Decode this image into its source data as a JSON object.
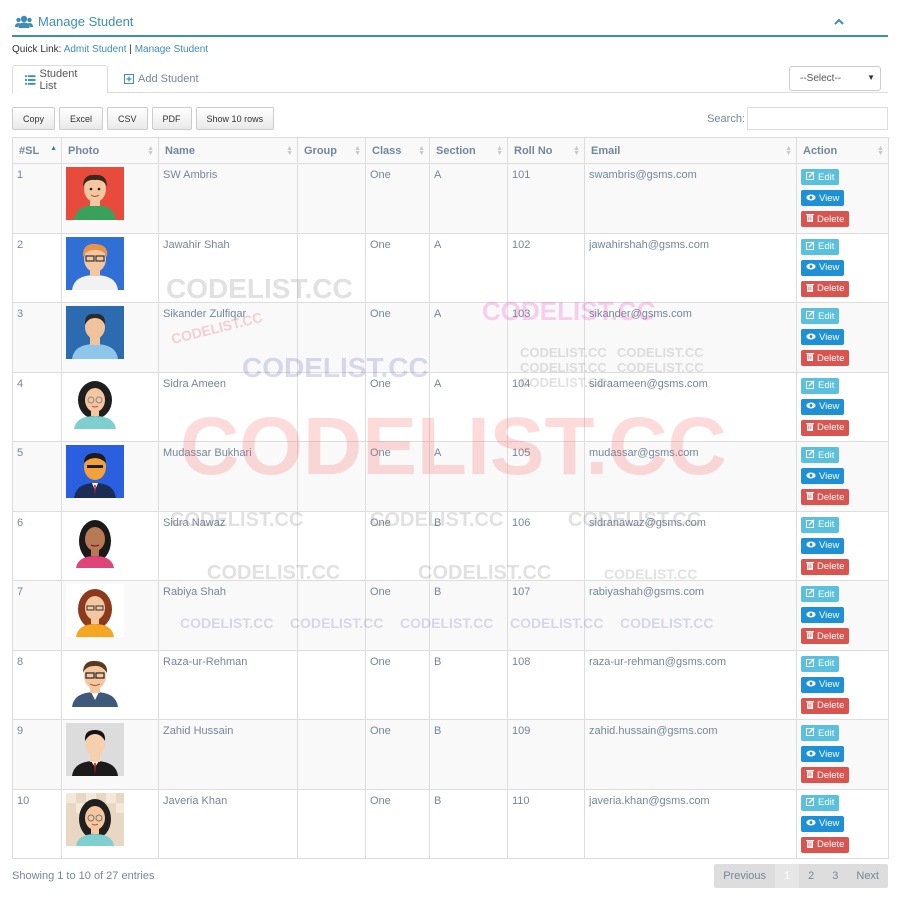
{
  "header": {
    "title": "Manage Student",
    "collapse_icon": "chevron-up-icon"
  },
  "quicklink": {
    "label": "Quick Link:",
    "link1": "Admit Student",
    "sep": "|",
    "link2": "Manage Student"
  },
  "tabs": {
    "student_list": "Student List",
    "add_student": "Add Student"
  },
  "select": {
    "value": "--Select--"
  },
  "buttons": {
    "copy": "Copy",
    "excel": "Excel",
    "csv": "CSV",
    "pdf": "PDF",
    "show_rows": "Show 10 rows"
  },
  "search": {
    "label": "Search:",
    "value": ""
  },
  "columns": [
    "#SL",
    "Photo",
    "Name",
    "Group",
    "Class",
    "Section",
    "Roll No",
    "Email",
    "Action"
  ],
  "actions": {
    "edit": "Edit",
    "view": "View",
    "delete": "Delete"
  },
  "rows": [
    {
      "sl": "1",
      "name": "SW Ambris",
      "group": "",
      "class": "One",
      "section": "A",
      "roll": "101",
      "email": "swambris@gsms.com",
      "avatar": "boy-green"
    },
    {
      "sl": "2",
      "name": "Jawahir Shah",
      "group": "",
      "class": "One",
      "section": "A",
      "roll": "102",
      "email": "jawahirshah@gsms.com",
      "avatar": "man-glasses-blue"
    },
    {
      "sl": "3",
      "name": "Sikander Zulfiqar",
      "group": "",
      "class": "One",
      "section": "A",
      "roll": "103",
      "email": "sikander@gsms.com",
      "avatar": "man-blank-blue"
    },
    {
      "sl": "4",
      "name": "Sidra Ameen",
      "group": "",
      "class": "One",
      "section": "A",
      "roll": "104",
      "email": "sidraameen@gsms.com",
      "avatar": "woman-glasses"
    },
    {
      "sl": "5",
      "name": "Mudassar Bukhari",
      "group": "",
      "class": "One",
      "section": "A",
      "roll": "105",
      "email": "mudassar@gsms.com",
      "avatar": "man-orange-blue"
    },
    {
      "sl": "6",
      "name": "Sidra Nawaz",
      "group": "",
      "class": "One",
      "section": "B",
      "roll": "106",
      "email": "sidranawaz@gsms.com",
      "avatar": "woman-dark"
    },
    {
      "sl": "7",
      "name": "Rabiya Shah",
      "group": "",
      "class": "One",
      "section": "B",
      "roll": "107",
      "email": "rabiyashah@gsms.com",
      "avatar": "woman-red-hair"
    },
    {
      "sl": "8",
      "name": "Raza-ur-Rehman",
      "group": "",
      "class": "One",
      "section": "B",
      "roll": "108",
      "email": "raza-ur-rehman@gsms.com",
      "avatar": "man-suit-glasses"
    },
    {
      "sl": "9",
      "name": "Zahid Hussain",
      "group": "",
      "class": "One",
      "section": "B",
      "roll": "109",
      "email": "zahid.hussain@gsms.com",
      "avatar": "man-suit-red-tie"
    },
    {
      "sl": "10",
      "name": "Javeria Khan",
      "group": "",
      "class": "One",
      "section": "B",
      "roll": "110",
      "email": "javeria.khan@gsms.com",
      "avatar": "woman-glasses-checker"
    }
  ],
  "footer": {
    "info": "Showing 1 to 10 of 27 entries",
    "previous": "Previous",
    "pages": [
      "1",
      "2",
      "3"
    ],
    "next": "Next"
  },
  "watermark": "CODELIST.CC",
  "colors": {
    "accent": "#3c8dbc",
    "edit": "#5bc0de",
    "view": "#1e90d6",
    "delete": "#d9534f"
  }
}
